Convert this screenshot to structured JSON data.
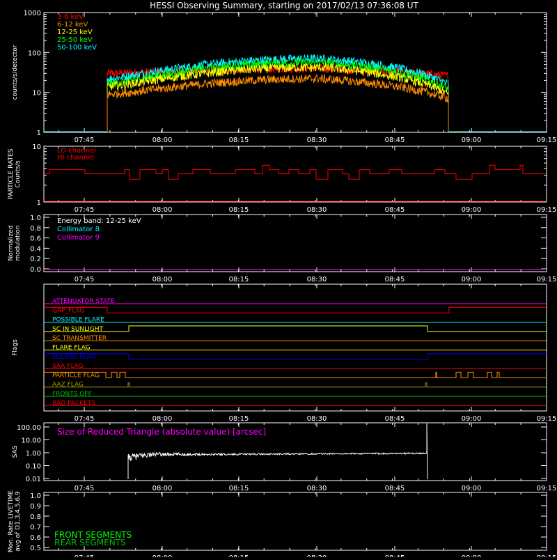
{
  "title": "HESSI Observing Summary, starting on 2017/02/13 07:36:08 UT",
  "time_ticks": [
    "07:45",
    "08:00",
    "08:15",
    "08:30",
    "08:45",
    "09:00",
    "09:15"
  ],
  "colors": {
    "frame": "#ffffff",
    "band_3_6": "#ff0000",
    "band_6_12": "#ff8c00",
    "band_12_25": "#ffff00",
    "band_25_50": "#00ff00",
    "band_50_100": "#00ffff",
    "magenta": "#ff00ff",
    "blue": "#0000ff",
    "flag_green": "#00c000",
    "flag_olive": "#a0a000"
  },
  "chart_data": [
    {
      "type": "line",
      "panel": "count-rates",
      "ylabel": "counts/s/detector",
      "yscale": "log",
      "ylim": [
        1,
        1000
      ],
      "yticks": [
        "1",
        "10",
        "100",
        "1000"
      ],
      "xlim_minutes": [
        0,
        99.9
      ],
      "data_span_minutes": [
        10.3,
        80.8
      ],
      "series": [
        {
          "name": "3-6 keV",
          "color": "#ff0000",
          "start": 30,
          "peak": 40,
          "end": 26
        },
        {
          "name": "6-12 keV",
          "color": "#ff8c00",
          "start": 9,
          "peak": 22,
          "end": 7
        },
        {
          "name": "12-25 keV",
          "color": "#ffff00",
          "start": 14,
          "peak": 42,
          "end": 9
        },
        {
          "name": "25-50 keV",
          "color": "#00ff00",
          "start": 16,
          "peak": 55,
          "end": 12
        },
        {
          "name": "50-100 keV",
          "color": "#00ffff",
          "start": 22,
          "peak": 70,
          "end": 16
        }
      ]
    },
    {
      "type": "line",
      "panel": "particle-rates",
      "ylabel": "PARTICLE RATES\nCounts/s",
      "yscale": "log",
      "ylim": [
        1,
        10
      ],
      "yticks": [
        "1",
        "10"
      ],
      "series": [
        {
          "name": "LO channel",
          "color": "#ff0000",
          "low": 3.2,
          "high": 3.8
        },
        {
          "name": "HI channel",
          "color": "#ff0000",
          "value": 1
        }
      ]
    },
    {
      "type": "line",
      "panel": "modulation",
      "ylabel": "Normalized\nmodulation",
      "ylim": [
        0,
        1
      ],
      "yticks": [
        "0.0",
        "0.2",
        "0.4",
        "0.6",
        "0.8",
        "1.0"
      ],
      "annotation": "Energy band: 12-25 keV",
      "series": [
        {
          "name": "Collimator 8",
          "color": "#00ffff",
          "value": 0
        },
        {
          "name": "Collimator 9",
          "color": "#ff00ff",
          "value": 0
        }
      ]
    },
    {
      "type": "line",
      "panel": "flags",
      "ylabel": "Flags",
      "flags": [
        {
          "name": "ATTENUATOR STATE",
          "color": "#ff00ff"
        },
        {
          "name": "GAP_FLAG",
          "color": "#ff0000"
        },
        {
          "name": "POSSIBLE FLARE",
          "color": "#00ffff"
        },
        {
          "name": "SC IN SUNLIGHT",
          "color": "#ffff00"
        },
        {
          "name": "SC TRANSMITTER",
          "color": "#ff8c00"
        },
        {
          "name": "FLARE FLAG",
          "color": "#ffff00"
        },
        {
          "name": "ECLIPSE FLAG",
          "color": "#0000ff"
        },
        {
          "name": "SAA FLAG",
          "color": "#ff0000"
        },
        {
          "name": "PARTICLE FLAG",
          "color": "#ff8c00"
        },
        {
          "name": "AAZ FLAG",
          "color": "#a0a000"
        },
        {
          "name": "FRONTS OFF",
          "color": "#00c000"
        },
        {
          "name": "BAD PACKETS",
          "color": "#ff0000"
        }
      ]
    },
    {
      "type": "line",
      "panel": "sas",
      "ylabel": "SAS",
      "yscale": "log",
      "ylim": [
        0.01,
        100
      ],
      "yticks": [
        "0.01",
        "0.10",
        "1.00",
        "10.00",
        "100.00"
      ],
      "annotation": "Size of Reduced Triangle (absolute value) [arcsec]",
      "series": [
        {
          "name": "Size of Reduced Triangle",
          "color": "#ffffff",
          "start": 0.4,
          "level": 0.75,
          "end": 0.9
        }
      ]
    },
    {
      "type": "line",
      "panel": "livetime",
      "ylabel": "Mon. Rate LIVETIME\navg of D1,3,4,5,6,9",
      "ylim": [
        0.5,
        1
      ],
      "yticks": [
        "0.5",
        "0.6",
        "0.7",
        "0.8",
        "0.9",
        "1.0"
      ],
      "series": [
        {
          "name": "FRONT SEGMENTS",
          "color": "#00ff00"
        },
        {
          "name": "REAR SEGMENTS",
          "color": "#00c000"
        }
      ]
    }
  ]
}
